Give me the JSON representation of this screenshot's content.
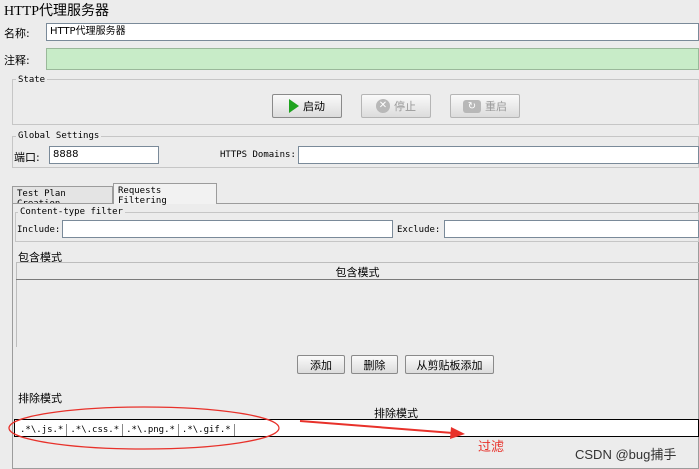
{
  "window": {
    "title": "HTTP代理服务器"
  },
  "name_field": {
    "label": "名称:",
    "value": "HTTP代理服务器"
  },
  "comment_field": {
    "label": "注释:",
    "value": ""
  },
  "state": {
    "legend": "State",
    "start_label": "启动",
    "stop_label": "停止",
    "restart_label": "重启"
  },
  "global": {
    "legend": "Global Settings",
    "port_label": "端口:",
    "port_value": "8888",
    "https_label": "HTTPS Domains:",
    "https_value": ""
  },
  "tabs": [
    {
      "label": "Test Plan Creation",
      "active": false
    },
    {
      "label": "Requests Filtering",
      "active": true
    }
  ],
  "content_filter": {
    "legend": "Content-type filter",
    "include_label": "Include:",
    "include_value": "",
    "exclude_label": "Exclude:",
    "exclude_value": ""
  },
  "include_patterns": {
    "section_label": "包含模式",
    "column_header": "包含模式",
    "add_label": "添加",
    "delete_label": "删除",
    "paste_label": "从剪贴板添加"
  },
  "exclude_patterns": {
    "section_label": "排除模式",
    "column_header": "排除模式",
    "values": [
      ".*\\.js.*",
      ".*\\.css.*",
      ".*\\.png.*",
      ".*\\.gif.*"
    ]
  },
  "annotation": {
    "text": "过滤",
    "color": "#e8312a"
  },
  "watermark": {
    "text": "CSDN @bug捕手"
  }
}
